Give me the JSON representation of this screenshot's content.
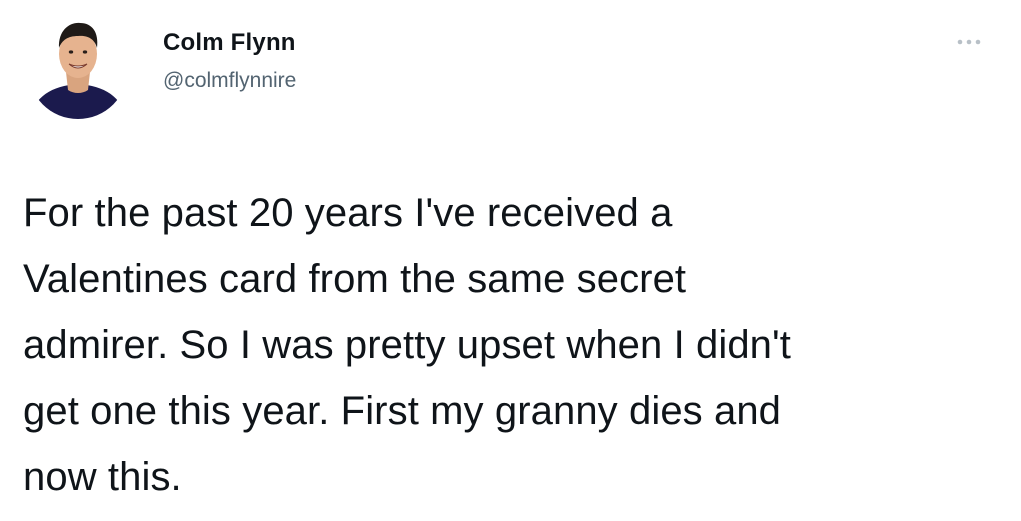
{
  "author": {
    "display_name": "Colm Flynn",
    "handle": "@colmflynnire",
    "avatar_icon": "profile-photo",
    "avatar_shirt_color": "#1b1a4d"
  },
  "menu": {
    "more_icon": "more-options-icon"
  },
  "tweet": {
    "lines": [
      "For the past 20 years I've received a",
      "Valentines card from the same secret",
      "admirer. So I was pretty upset when I didn't",
      "get one this year. First my granny dies and",
      "now this."
    ]
  }
}
